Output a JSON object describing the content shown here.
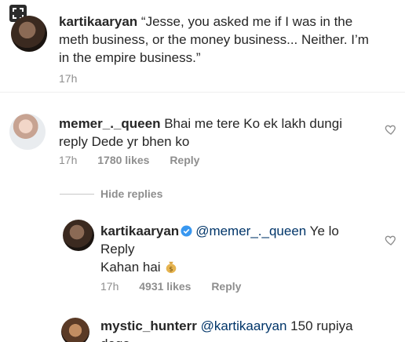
{
  "caption": {
    "username": "kartikaaryan",
    "text_line1": "“Jesse, you asked me if I was in the",
    "text_line2": "meth business, or the money business... Neither. I’m",
    "text_line3": "in the empire business.”",
    "time": "17h"
  },
  "comment": {
    "username": "memer_._queen",
    "text_line1": "Bhai me tere Ko ek lakh dungi",
    "text_line2": "reply Dede yr bhen ko",
    "time": "17h",
    "likes": "1780 likes",
    "reply_label": "Reply"
  },
  "hide_replies_label": "Hide replies",
  "reply_comment": {
    "username": "kartikaaryan",
    "mention": "@memer_._queen",
    "text_after_mention": "Ye lo",
    "text_line2": "Reply",
    "text_line3": "Kahan hai",
    "time": "17h",
    "likes": "4931 likes",
    "reply_label": "Reply"
  },
  "next_comment": {
    "username": "mystic_hunterr",
    "mention": "@kartikaaryan",
    "text": "150 rupiya",
    "text_line2": "dega"
  },
  "icons": {
    "expand": "expand-icon",
    "verified": "verified-badge-icon",
    "heart": "heart-icon",
    "money_bag": "money-bag-emoji"
  },
  "colors": {
    "text": "#262626",
    "secondary": "#8e8e8e",
    "mention": "#003569",
    "verified": "#3897f0"
  }
}
